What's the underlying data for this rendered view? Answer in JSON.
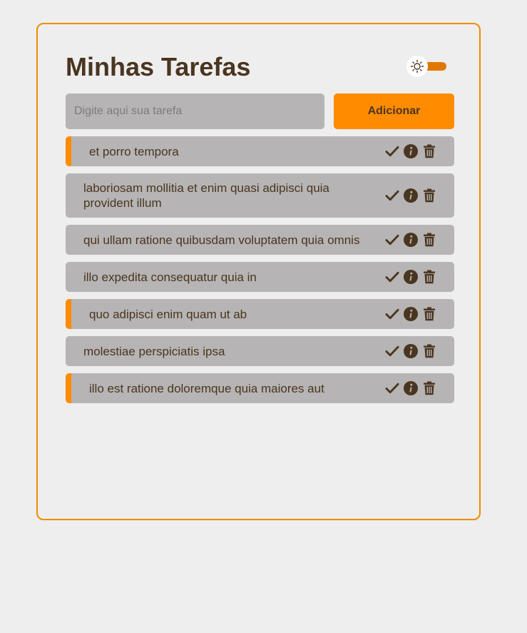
{
  "header": {
    "title": "Minhas Tarefas"
  },
  "theme_toggle": {
    "icon": "sun-icon",
    "state": "light"
  },
  "input": {
    "placeholder": "Digite aqui sua tarefa",
    "value": ""
  },
  "add_button": {
    "label": "Adicionar"
  },
  "colors": {
    "accent": "#ff8c00",
    "text": "#4a3520",
    "task_bg": "#b6b4b4",
    "page_bg": "#eeeeee"
  },
  "tasks": [
    {
      "text": "et porro tempora",
      "flagged": true
    },
    {
      "text": "laboriosam mollitia et enim quasi adipisci quia provident illum",
      "flagged": false
    },
    {
      "text": "qui ullam ratione quibusdam voluptatem quia omnis",
      "flagged": false
    },
    {
      "text": "illo expedita consequatur quia in",
      "flagged": false
    },
    {
      "text": "quo adipisci enim quam ut ab",
      "flagged": true
    },
    {
      "text": "molestiae perspiciatis ipsa",
      "flagged": false
    },
    {
      "text": "illo est ratione doloremque quia maiores aut",
      "flagged": true
    }
  ],
  "task_actions": [
    "check-icon",
    "info-icon",
    "trash-icon"
  ]
}
